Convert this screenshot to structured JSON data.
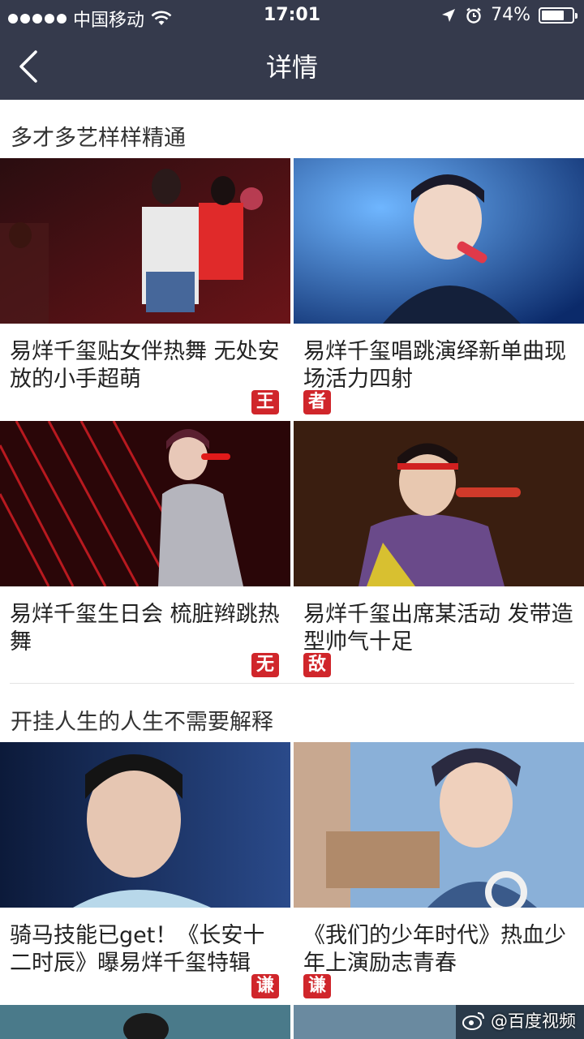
{
  "status_bar": {
    "carrier": "中国移动",
    "time": "17:01",
    "battery_text": "74%",
    "battery_level": 0.74
  },
  "nav": {
    "title": "详情"
  },
  "sections": [
    {
      "title": "多才多艺样样精通",
      "cards": [
        {
          "title": "易烊千玺贴女伴热舞 无处安放的小手超萌",
          "badge": "王",
          "badge_pos": "right"
        },
        {
          "title": "易烊千玺唱跳演绎新单曲现场活力四射",
          "badge": "者",
          "badge_pos": "left"
        },
        {
          "title": "易烊千玺生日会 梳脏辫跳热舞",
          "badge": "无",
          "badge_pos": "right"
        },
        {
          "title": "易烊千玺出席某活动 发带造型帅气十足",
          "badge": "敌",
          "badge_pos": "left"
        }
      ]
    },
    {
      "title": "开挂人生的人生不需要解释",
      "cards": [
        {
          "title": "骑马技能已get！《长安十二时辰》曝易烊千玺特辑",
          "badge": "谦",
          "badge_pos": "right"
        },
        {
          "title": "《我们的少年时代》热血少年上演励志青春",
          "badge": "谦",
          "badge_pos": "left"
        }
      ]
    }
  ],
  "watermark": "@百度视频",
  "colors": {
    "header_bg": "#353a4c",
    "badge_red": "#d0262b"
  },
  "icons": [
    "signal-dots-icon",
    "wifi-icon",
    "location-arrow-icon",
    "alarm-icon",
    "battery-icon",
    "back-chevron-icon",
    "weibo-icon"
  ]
}
